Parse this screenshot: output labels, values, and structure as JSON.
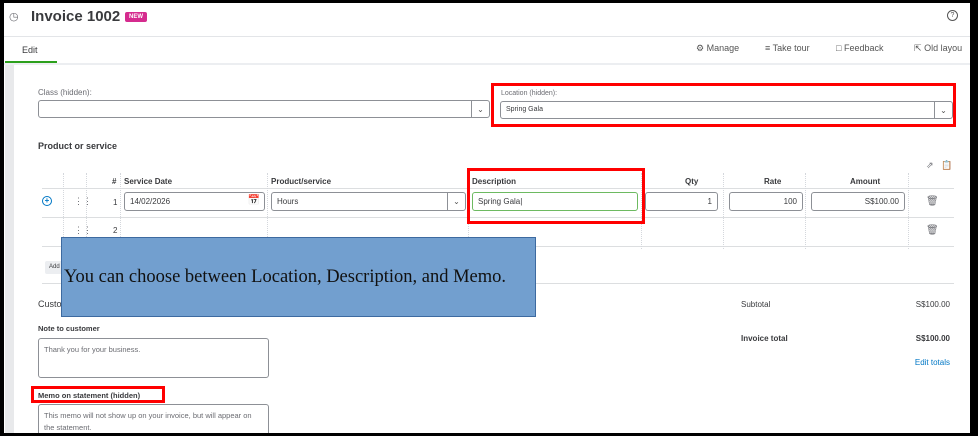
{
  "header": {
    "title": "Invoice 1002",
    "badge": "NEW",
    "history_icon": "clock-icon",
    "help_icon": "help-icon"
  },
  "tabs": {
    "edit": "Edit"
  },
  "toolbar": {
    "manage": "Manage",
    "take_tour": "Take tour",
    "feedback": "Feedback",
    "old_layout": "Old layou"
  },
  "fields": {
    "class_label": "Class (hidden):",
    "class_value": "",
    "location_label": "Location (hidden):",
    "location_value": "Spring Gala"
  },
  "products": {
    "section_title": "Product or service",
    "columns": {
      "num": "#",
      "service_date": "Service Date",
      "product": "Product/service",
      "description": "Description",
      "qty": "Qty",
      "rate": "Rate",
      "amount": "Amount"
    },
    "rows": [
      {
        "num": "1",
        "service_date": "14/02/2026",
        "product": "Hours",
        "description": "Spring Gala",
        "qty": "1",
        "rate": "100",
        "amount": "S$100.00"
      },
      {
        "num": "2"
      }
    ],
    "add_label": "Add"
  },
  "callout": "You can choose between Location, Description, and Memo.",
  "customer": {
    "section_partial": "Custo",
    "note_label": "Note to customer",
    "note_value": "Thank you for your business.",
    "memo_label": "Memo on statement (hidden)",
    "memo_value": "This memo will not show up on your invoice, but will appear on the statement."
  },
  "totals": {
    "subtotal_label": "Subtotal",
    "subtotal_value": "S$100.00",
    "total_label": "Invoice total",
    "total_value": "S$100.00",
    "edit_totals": "Edit totals"
  },
  "colors": {
    "accent_green": "#2ca01c",
    "badge": "#d52b8e",
    "link": "#0077c5",
    "callout": "#729fcf",
    "highlight": "#ff0000"
  }
}
